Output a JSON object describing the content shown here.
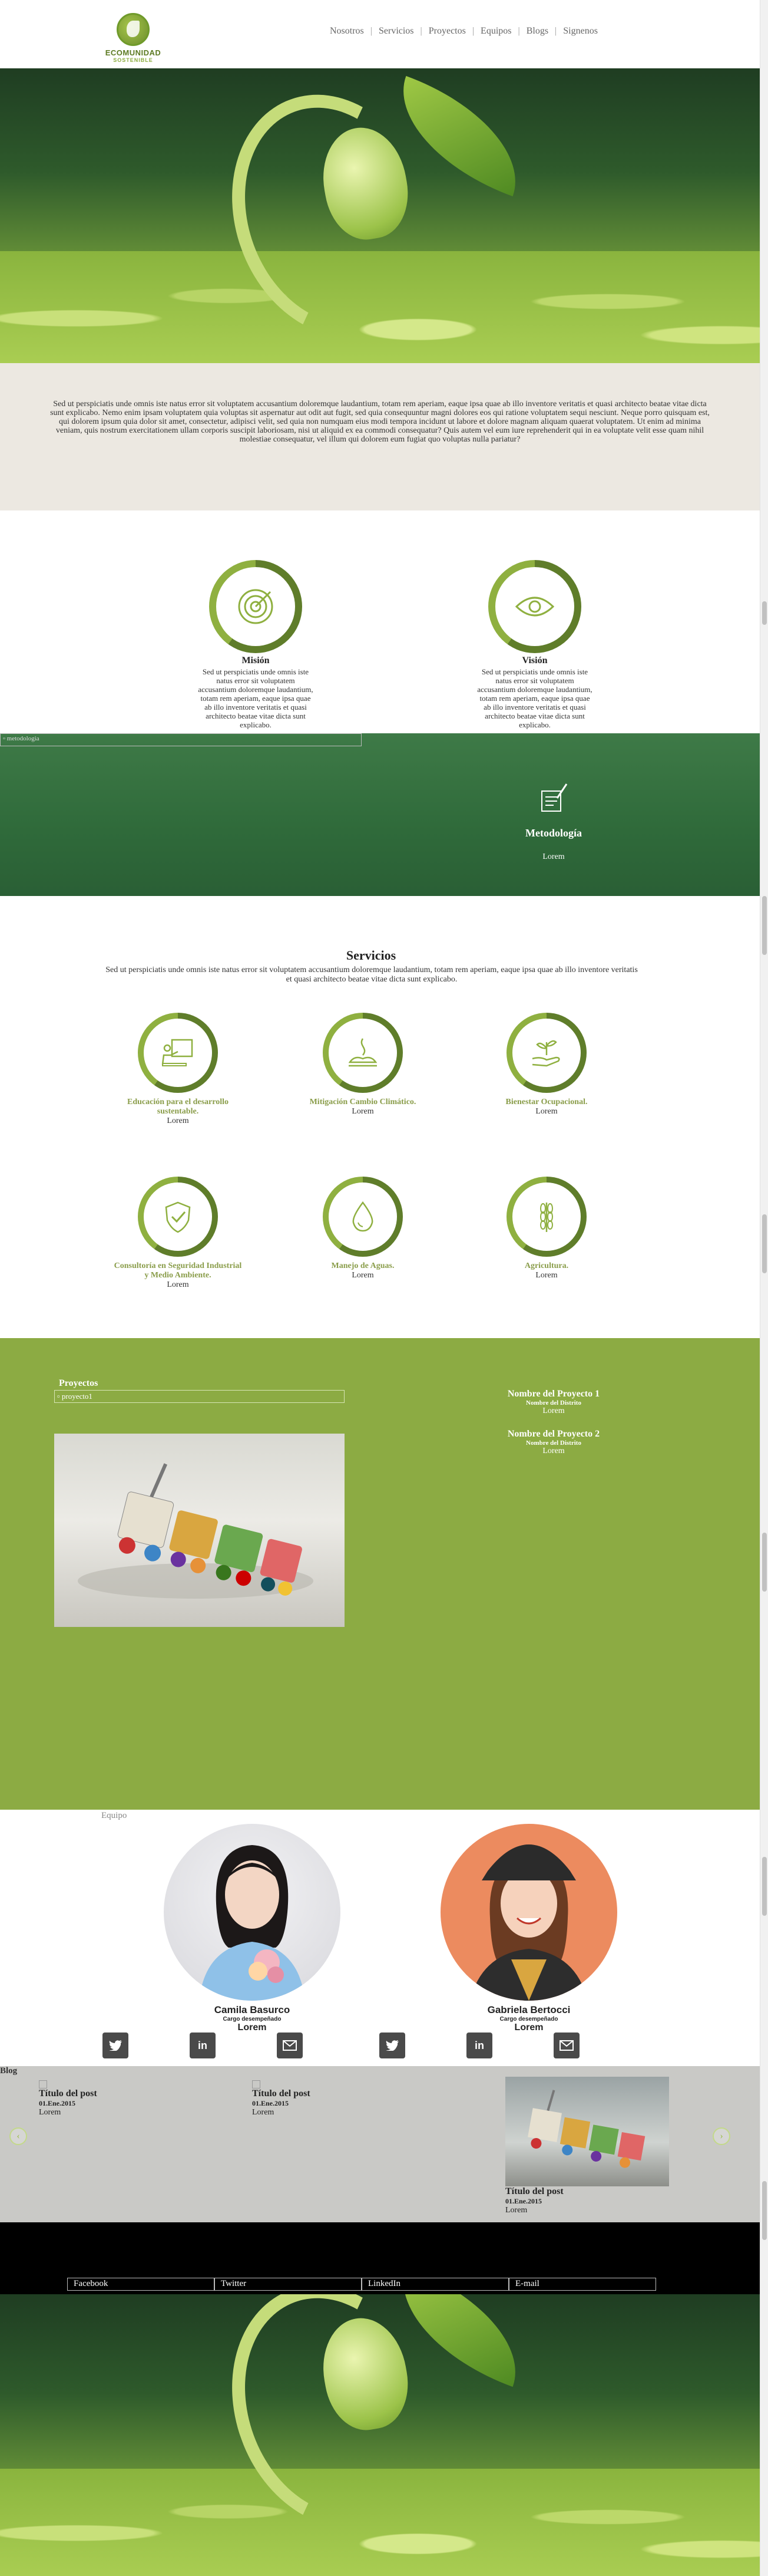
{
  "header": {
    "logo": {
      "line1": "ECOMUNIDAD",
      "line2": "SOSTENIBLE"
    },
    "nav": [
      "Nosotros",
      "Servicios",
      "Proyectos",
      "Equipos",
      "Blogs",
      "Signenos"
    ]
  },
  "intro": {
    "text": "Sed ut perspiciatis unde omnis iste natus error sit voluptatem accusantium doloremque laudantium, totam rem aperiam, eaque ipsa quae ab illo inventore veritatis et quasi architecto beatae vitae dicta sunt explicabo. Nemo enim ipsam voluptatem quia voluptas sit aspernatur aut odit aut fugit, sed quia consequuntur magni dolores eos qui ratione voluptatem sequi nesciunt. Neque porro quisquam est, qui dolorem ipsum quia dolor sit amet, consectetur, adipisci velit, sed quia non numquam eius modi tempora incidunt ut labore et dolore magnam aliquam quaerat voluptatem. Ut enim ad minima veniam, quis nostrum exercitationem ullam corporis suscipit laboriosam, nisi ut aliquid ex ea commodi consequatur? Quis autem vel eum iure reprehenderit qui in ea voluptate velit esse quam nihil molestiae consequatur, vel illum qui dolorem eum fugiat quo voluptas nulla pariatur?"
  },
  "mission": {
    "title": "Misión",
    "text": "Sed ut perspiciatis unde omnis iste natus error sit voluptatem accusantium doloremque laudantium, totam rem aperiam, eaque ipsa quae ab illo inventore veritatis et quasi architecto beatae vitae dicta sunt explicabo."
  },
  "vision": {
    "title": "Visión",
    "text": "Sed ut perspiciatis unde omnis iste natus error sit voluptatem accusantium doloremque laudantium, totam rem aperiam, eaque ipsa quae ab illo inventore veritatis et quasi architecto beatae vitae dicta sunt explicabo."
  },
  "methodology": {
    "broken_image_alt": "metodologia",
    "title": "Metodología",
    "text": "Lorem"
  },
  "services": {
    "title": "Servicios",
    "desc": "Sed ut perspiciatis unde omnis iste natus error sit voluptatem accusantium doloremque laudantium, totam rem aperiam, eaque ipsa quae ab illo inventore veritatis et quasi architecto beatae vitae dicta sunt explicabo.",
    "items": [
      {
        "label": "Educación para el desarrollo sustentable.",
        "sub": "Lorem",
        "icon": "presentation-icon"
      },
      {
        "label": "Mitigación Cambio Climático.",
        "sub": "Lorem",
        "icon": "climate-icon"
      },
      {
        "label": "Bienestar Ocupacional.",
        "sub": "Lorem",
        "icon": "hand-plant-icon"
      },
      {
        "label": "Consultoría en Seguridad Industrial y Medio Ambiente.",
        "sub": "Lorem",
        "icon": "shield-check-icon"
      },
      {
        "label": "Manejo de Aguas.",
        "sub": "Lorem",
        "icon": "water-drop-icon"
      },
      {
        "label": "Agricultura.",
        "sub": "Lorem",
        "icon": "wheat-icon"
      }
    ]
  },
  "projects": {
    "title": "Proyectos",
    "broken_image_alt": "proyecto1",
    "list": [
      {
        "name": "Nombre del Proyecto 1",
        "district": "Nombre del Distrito",
        "text": "Lorem"
      },
      {
        "name": "Nombre del Proyecto 2",
        "district": "Nombre del Distrito",
        "text": "Lorem"
      }
    ]
  },
  "team": {
    "label": "Equipo",
    "members": [
      {
        "name": "Camila Basurco",
        "role": "Cargo desempeñado",
        "text": "Lorem"
      },
      {
        "name": "Gabriela Bertocci",
        "role": "Cargo desempeñado",
        "text": "Lorem"
      }
    ]
  },
  "blog": {
    "label": "Blog",
    "posts": [
      {
        "title": "Título del post",
        "date": "01.Ene.2015",
        "text": "Lorem"
      },
      {
        "title": "Título del post",
        "date": "01.Ene.2015",
        "text": "Lorem"
      },
      {
        "title": "Título del post",
        "date": "01.Ene.2015",
        "text": "Lorem"
      }
    ],
    "prev": "‹",
    "next": "›"
  },
  "footer": {
    "links": [
      "Facebook",
      "Twitter",
      "LinkedIn",
      "E-mail"
    ]
  },
  "colors": {
    "accent": "#8cab43",
    "dark_green": "#5f7d2a",
    "footer": "#000000"
  }
}
